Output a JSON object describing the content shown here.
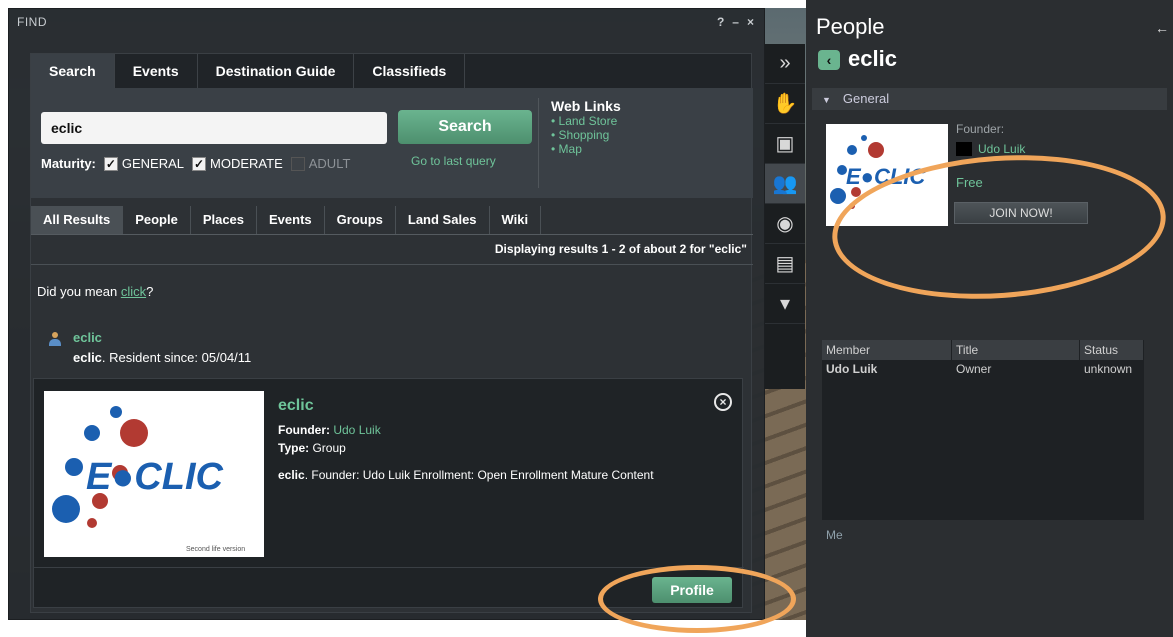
{
  "find_window": {
    "title": "FIND",
    "controls": [
      "?",
      "–",
      "×"
    ],
    "top_tabs": [
      "Search",
      "Events",
      "Destination Guide",
      "Classifieds"
    ],
    "search_value": "eclic",
    "search_button": "Search",
    "last_query": "Go to last query",
    "maturity": {
      "label": "Maturity:",
      "options": [
        {
          "label": "GENERAL",
          "checked": true
        },
        {
          "label": "MODERATE",
          "checked": true
        },
        {
          "label": "ADULT",
          "checked": false
        }
      ]
    },
    "web_links": {
      "title": "Web Links",
      "items": [
        "• Land Store",
        "• Shopping",
        "• Map"
      ]
    },
    "sub_tabs": [
      "All Results",
      "People",
      "Places",
      "Events",
      "Groups",
      "Land Sales",
      "Wiki"
    ],
    "displaying": "Displaying results 1 - 2 of about 2 for \"eclic\"",
    "did_you_mean": {
      "prefix": "Did you mean ",
      "word": "click",
      "suffix": "?"
    },
    "person_result": {
      "name": "eclic",
      "desc_bold": "eclic",
      "desc_rest": ". Resident since: 05/04/11"
    },
    "group_result": {
      "title": "eclic",
      "founder_label": "Founder:",
      "founder_name": "Udo Luik",
      "type_label": "Type:",
      "type_value": "Group",
      "desc_bold": "eclic",
      "desc_rest": ". Founder: Udo Luik Enrollment: Open Enrollment Mature Content",
      "profile_button": "Profile",
      "logo_caption": "Second life version"
    }
  },
  "people_panel": {
    "title": "People",
    "group_name": "eclic",
    "section": "General",
    "founder_label": "Founder:",
    "founder_name": "Udo Luik",
    "fee": "Free",
    "join_button": "JOIN NOW!",
    "member_columns": [
      "Member",
      "Title",
      "Status"
    ],
    "members": [
      {
        "member": "Udo Luik",
        "title": "Owner",
        "status": "unknown"
      }
    ],
    "me_label": "Me"
  },
  "logo": {
    "text": "E●CLIC"
  },
  "colors": {
    "accent_green": "#6fc49a",
    "highlight_orange": "#f0a55a",
    "logo_blue": "#1b5fb0",
    "logo_red": "#b23a32"
  }
}
